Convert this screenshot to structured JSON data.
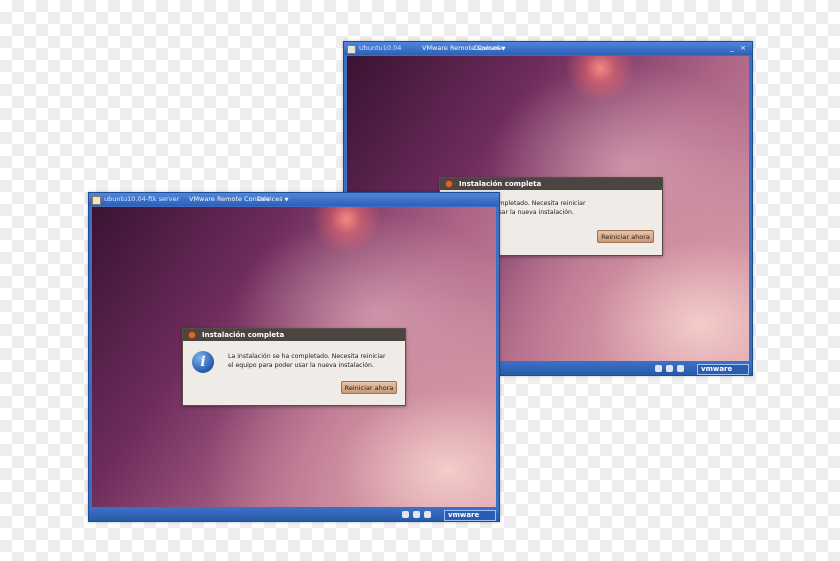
{
  "windows": {
    "back": {
      "vm_title": "Ubuntu10.04",
      "console_menu": "VMware Remote Console",
      "devices_menu": "Devices",
      "statusbar_brand": "vmware",
      "dialog": {
        "title": "Instalación completa",
        "message_line1": "La instalación se ha completado. Necesita reiniciar",
        "message_line2": "el equipo para poder usar la nueva instalación.",
        "button_label": "Reiniciar ahora"
      }
    },
    "front": {
      "vm_title": "ubuntu10.04-ftk server",
      "console_menu": "VMware Remote Console",
      "devices_menu": "Devices",
      "statusbar_brand": "vmware",
      "dialog": {
        "title": "Instalación completa",
        "message_line1": "La instalación se ha completado. Necesita reiniciar",
        "message_line2": "el equipo para poder usar la nueva instalación.",
        "button_label": "Reiniciar ahora"
      }
    }
  },
  "window_controls": {
    "minimize": "_",
    "maximize": "□",
    "close": "×"
  },
  "colors": {
    "titlebar_blue": "#2d5fb7",
    "dialog_title_bg": "#4b4542",
    "dialog_bg": "#efebe7",
    "button_tan": "#c99a7a",
    "close_orange": "#e0662f",
    "info_blue": "#2b5fb3"
  },
  "icons": [
    "app-icon",
    "close-icon",
    "info-icon",
    "network-icon",
    "usb-icon",
    "sound-icon"
  ]
}
